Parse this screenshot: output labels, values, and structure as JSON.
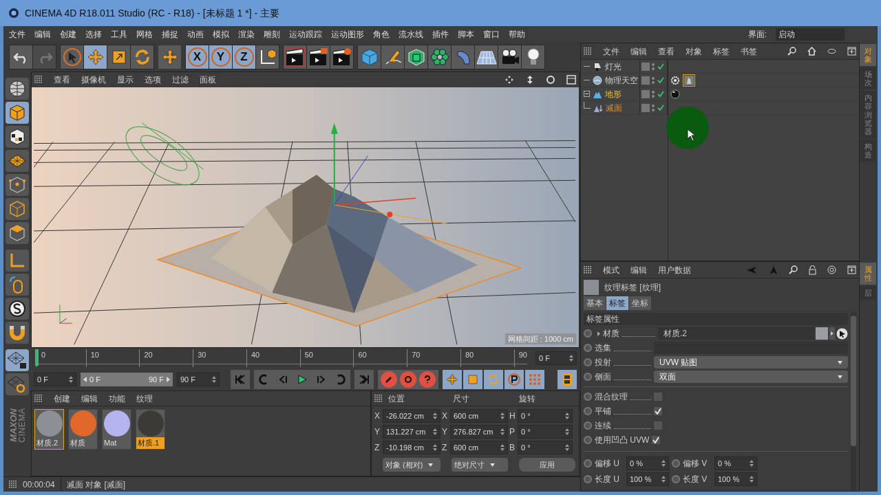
{
  "window": {
    "title": "CINEMA 4D R18.011 Studio (RC - R18) - [未标题 1 *] - 主要"
  },
  "menu": [
    "文件",
    "编辑",
    "创建",
    "选择",
    "工具",
    "网格",
    "捕捉",
    "动画",
    "模拟",
    "渲染",
    "雕刻",
    "运动跟踪",
    "运动图形",
    "角色",
    "流水线",
    "插件",
    "脚本",
    "窗口",
    "帮助"
  ],
  "layout": {
    "label": "界面:",
    "value": "启动"
  },
  "toolbar": [
    [
      {
        "kind": "undo",
        "selected": false,
        "disabled": false
      },
      {
        "kind": "redo",
        "selected": false,
        "disabled": true
      }
    ],
    [
      {
        "kind": "select",
        "selected": false,
        "disabled": false
      },
      {
        "kind": "move",
        "selected": true,
        "disabled": false
      },
      {
        "kind": "scale",
        "selected": false,
        "disabled": false
      },
      {
        "kind": "rotate",
        "selected": false,
        "disabled": false
      }
    ],
    [
      {
        "kind": "move",
        "selected": false,
        "disabled": false
      }
    ],
    [
      {
        "kind": "axis",
        "label": "X",
        "selected": true,
        "disabled": false
      },
      {
        "kind": "axis",
        "label": "Y",
        "selected": true,
        "disabled": false
      },
      {
        "kind": "axis",
        "label": "Z",
        "selected": true,
        "disabled": false
      },
      {
        "kind": "coords",
        "selected": false,
        "disabled": false
      }
    ],
    [
      {
        "kind": "render-region",
        "selected": false,
        "disabled": false
      },
      {
        "kind": "render-view",
        "selected": false,
        "disabled": false
      },
      {
        "kind": "render-settings",
        "selected": false,
        "disabled": false
      }
    ],
    [
      {
        "kind": "cube",
        "selected": false,
        "disabled": false
      },
      {
        "kind": "pen",
        "selected": false,
        "disabled": false
      },
      {
        "kind": "subdivide",
        "selected": false,
        "disabled": false
      },
      {
        "kind": "cloner",
        "selected": false,
        "disabled": false
      },
      {
        "kind": "deformer",
        "selected": false,
        "disabled": false
      },
      {
        "kind": "floor",
        "selected": false,
        "disabled": false
      },
      {
        "kind": "camera",
        "selected": false,
        "disabled": false
      },
      {
        "kind": "light",
        "selected": false,
        "disabled": false
      }
    ]
  ],
  "left_toolbar": [
    {
      "kind": "editable",
      "selected": false
    },
    {
      "kind": "cube",
      "selected": true
    },
    {
      "kind": "checker",
      "selected": false
    },
    {
      "kind": "workplane",
      "selected": false
    },
    {
      "kind": "points",
      "selected": false
    },
    {
      "kind": "edges",
      "selected": false
    },
    {
      "kind": "polygons",
      "selected": false
    },
    {
      "kind": "axis-l",
      "selected": false
    },
    {
      "kind": "tweak",
      "selected": false
    },
    {
      "kind": "snap",
      "selected": false
    },
    {
      "kind": "magnet",
      "selected": false
    },
    {
      "kind": "workplane-lock",
      "selected": true
    },
    {
      "kind": "workplane-sync",
      "selected": false
    }
  ],
  "logo": [
    "MAXON",
    "CINEMA"
  ],
  "viewport": {
    "menu": [
      "查看",
      "摄像机",
      "显示",
      "选项",
      "过滤",
      "面板"
    ],
    "grid_spacing": "网格间距 : 1000 cm"
  },
  "timeline": {
    "ticks": [
      "0",
      "10",
      "20",
      "30",
      "40",
      "50",
      "60",
      "70",
      "80",
      "90"
    ],
    "level": 0,
    "current": "0 F"
  },
  "playback": {
    "start": "0 F",
    "range_start": "0 F",
    "range_end": "90 F",
    "level": 1,
    "end": "90 F",
    "modes": [
      {
        "kind": "move",
        "selected": true
      },
      {
        "kind": "scale",
        "selected": true
      },
      {
        "kind": "rotate",
        "selected": true
      },
      {
        "kind": "param",
        "selected": true
      },
      {
        "kind": "dots",
        "selected": true
      }
    ]
  },
  "materials": {
    "menu": [
      "创建",
      "编辑",
      "功能",
      "纹理"
    ],
    "items": [
      {
        "name": "材质.2",
        "color": "#8c9096",
        "selected": false,
        "linked": true
      },
      {
        "name": "材质",
        "color": "#e0662a",
        "selected": false,
        "linked": false
      },
      {
        "name": "Mat",
        "color": "#b4b4f0",
        "selected": false,
        "linked": false
      },
      {
        "name": "材质.1",
        "color": "#3c3a36",
        "selected": true,
        "linked": false
      }
    ]
  },
  "coordinates": {
    "headers": [
      "位置",
      "尺寸",
      "旋转"
    ],
    "rows": [
      {
        "axis": "X",
        "position": "-26.022 cm",
        "size_axis": "X",
        "size": "600 cm",
        "rotation_axis": "H",
        "rotation": "0 °"
      },
      {
        "axis": "Y",
        "position": "131.227 cm",
        "size_axis": "Y",
        "size": "276.827 cm",
        "rotation_axis": "P",
        "rotation": "0 °"
      },
      {
        "axis": "Z",
        "position": "-10.198 cm",
        "size_axis": "Z",
        "size": "600 cm",
        "rotation_axis": "B",
        "rotation": "0 °"
      }
    ],
    "mode": "对象 (相对)",
    "size_mode": "绝对尺寸",
    "apply": "应用"
  },
  "status_bar": {
    "time": "00:00:04",
    "message": "减面 对象 [减面]"
  },
  "objects": {
    "menu": [
      "文件",
      "编辑",
      "查看",
      "对象",
      "标签",
      "书签"
    ],
    "side_tabs": [
      {
        "label": "对象",
        "selected": true
      },
      {
        "label": "场次",
        "selected": false
      },
      {
        "label": "内容浏览器",
        "selected": false
      },
      {
        "label": "构造",
        "selected": false
      }
    ],
    "items": [
      {
        "name": "灯光",
        "kind": "light",
        "selected": false,
        "enabled": true
      },
      {
        "name": "物理天空",
        "kind": "sky",
        "selected": false,
        "enabled": true,
        "tags": [
          {
            "kind": "sky",
            "selected": false
          },
          {
            "kind": "material",
            "selected": true
          }
        ]
      },
      {
        "name": "地形",
        "kind": "landscape",
        "selected": true,
        "enabled": true,
        "expanded": true,
        "tags": [
          {
            "kind": "sphere",
            "selected": false
          }
        ],
        "children": [
          {
            "name": "减面",
            "kind": "reduction",
            "selected": true,
            "enabled": true
          }
        ]
      }
    ]
  },
  "attributes": {
    "menu": [
      "模式",
      "编辑",
      "用户数据"
    ],
    "title": "纹理标签 [纹理]",
    "tabs": [
      {
        "label": "基本",
        "selected": false
      },
      {
        "label": "标签",
        "selected": true
      },
      {
        "label": "坐标",
        "selected": false
      }
    ],
    "side_tabs": [
      {
        "label": "属性",
        "selected": true
      },
      {
        "label": "层",
        "selected": false
      }
    ],
    "section": "标签属性",
    "fields": [
      {
        "kind": "link",
        "label": "材质",
        "value": "材质.2"
      },
      {
        "kind": "text",
        "label": "选集"
      },
      {
        "kind": "dropdown",
        "label": "投射",
        "value": "UVW 贴图"
      },
      {
        "kind": "dropdown",
        "label": "侧面",
        "value": "双面"
      },
      {
        "kind": "checkbox",
        "label": "混合纹理",
        "checked": false
      },
      {
        "kind": "checkbox",
        "label": "平铺",
        "checked": true
      },
      {
        "kind": "checkbox",
        "label": "连续",
        "checked": false
      },
      {
        "kind": "checkbox",
        "label": "使用凹凸 UVW",
        "checked": true
      }
    ],
    "pairs": [
      {
        "label": "偏移 U",
        "value": "0 %",
        "label2": "偏移 V",
        "value2": "0 %"
      },
      {
        "label": "长度 U",
        "value": "100 %",
        "label2": "长度 V",
        "value2": "100 %"
      }
    ]
  }
}
